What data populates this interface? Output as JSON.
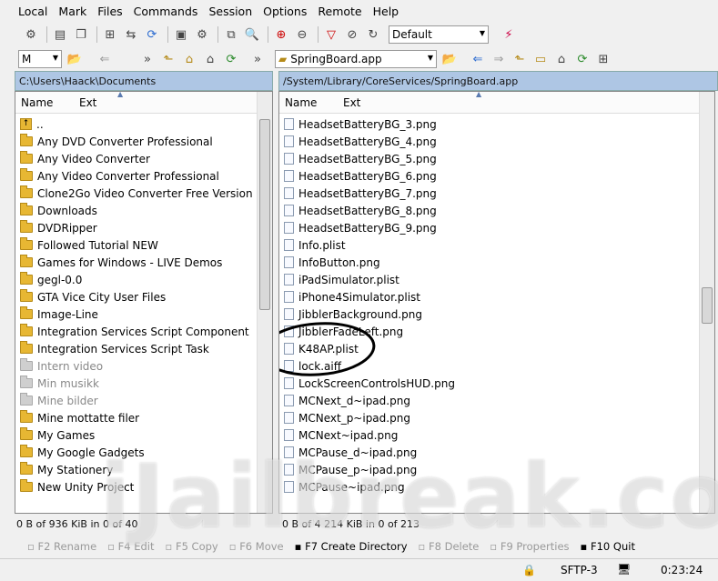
{
  "menu": [
    "Local",
    "Mark",
    "Files",
    "Commands",
    "Session",
    "Options",
    "Remote",
    "Help"
  ],
  "toolbar": {
    "profile": "Default"
  },
  "left": {
    "drive": "M",
    "path": "C:\\Users\\Haack\\Documents",
    "col_name": "Name",
    "col_ext": "Ext",
    "items": [
      {
        "label": "..",
        "type": "up"
      },
      {
        "label": "Any DVD Converter Professional",
        "type": "folder"
      },
      {
        "label": "Any Video Converter",
        "type": "folder"
      },
      {
        "label": "Any Video Converter Professional",
        "type": "folder"
      },
      {
        "label": "Clone2Go Video Converter Free Version",
        "type": "folder"
      },
      {
        "label": "Downloads",
        "type": "folder"
      },
      {
        "label": "DVDRipper",
        "type": "folder"
      },
      {
        "label": "Followed Tutorial NEW",
        "type": "folder"
      },
      {
        "label": "Games for Windows - LIVE Demos",
        "type": "folder"
      },
      {
        "label": "gegl-0.0",
        "type": "folder"
      },
      {
        "label": "GTA Vice City User Files",
        "type": "folder"
      },
      {
        "label": "Image-Line",
        "type": "folder"
      },
      {
        "label": "Integration Services Script Component",
        "type": "folder"
      },
      {
        "label": "Integration Services Script Task",
        "type": "folder"
      },
      {
        "label": "Intern video",
        "type": "dim"
      },
      {
        "label": "Min musikk",
        "type": "dim"
      },
      {
        "label": "Mine bilder",
        "type": "dim"
      },
      {
        "label": "Mine mottatte filer",
        "type": "folder"
      },
      {
        "label": "My Games",
        "type": "folder"
      },
      {
        "label": "My Google Gadgets",
        "type": "folder"
      },
      {
        "label": "My Stationery",
        "type": "folder"
      },
      {
        "label": "New Unity Project",
        "type": "folder"
      }
    ],
    "status": "0 B of 936 KiB in 0 of 40"
  },
  "right": {
    "dir": "SpringBoard.app",
    "path": "/System/Library/CoreServices/SpringBoard.app",
    "col_name": "Name",
    "col_ext": "Ext",
    "items": [
      "HeadsetBatteryBG_3.png",
      "HeadsetBatteryBG_4.png",
      "HeadsetBatteryBG_5.png",
      "HeadsetBatteryBG_6.png",
      "HeadsetBatteryBG_7.png",
      "HeadsetBatteryBG_8.png",
      "HeadsetBatteryBG_9.png",
      "Info.plist",
      "InfoButton.png",
      "iPadSimulator.plist",
      "iPhone4Simulator.plist",
      "JibblerBackground.png",
      "JibblerFadeLeft.png",
      "K48AP.plist",
      "lock.aiff",
      "LockScreenControlsHUD.png",
      "MCNext_d~ipad.png",
      "MCNext_p~ipad.png",
      "MCNext~ipad.png",
      "MCPause_d~ipad.png",
      "MCPause_p~ipad.png",
      "MCPause~ipad.png"
    ],
    "status": "0 B of 4 214 KiB in 0 of 213"
  },
  "fnkeys": [
    {
      "label": "F2 Rename",
      "enabled": false
    },
    {
      "label": "F4 Edit",
      "enabled": false
    },
    {
      "label": "F5 Copy",
      "enabled": false
    },
    {
      "label": "F6 Move",
      "enabled": false
    },
    {
      "label": "F7 Create Directory",
      "enabled": true
    },
    {
      "label": "F8 Delete",
      "enabled": false
    },
    {
      "label": "F9 Properties",
      "enabled": false
    },
    {
      "label": "F10 Quit",
      "enabled": true
    }
  ],
  "bottom": {
    "protocol": "SFTP-3",
    "time": "0:23:24"
  },
  "watermark": "iJailbreak.com"
}
